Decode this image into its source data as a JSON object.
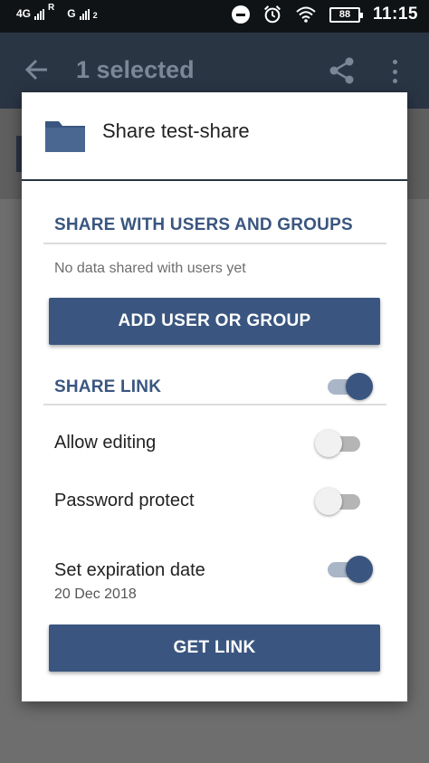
{
  "status_bar": {
    "network1": "4G",
    "roaming": "R",
    "network2": "G",
    "sim2": "2",
    "battery": "88",
    "time": "11:15"
  },
  "app_bar": {
    "title": "1 selected"
  },
  "dialog": {
    "title": "Share test-share",
    "users_section": {
      "title": "SHARE WITH USERS AND GROUPS",
      "empty_text": "No data shared with users yet",
      "add_button": "ADD USER OR GROUP"
    },
    "link_section": {
      "title": "SHARE LINK",
      "enabled": true,
      "options": [
        {
          "label": "Allow editing",
          "enabled": false
        },
        {
          "label": "Password protect",
          "enabled": false
        },
        {
          "label": "Set expiration date",
          "enabled": true,
          "sub": "20 Dec 2018"
        }
      ],
      "get_link_button": "GET LINK"
    }
  },
  "colors": {
    "accent": "#3a5680",
    "app_bar_dimmed": "#2a3544",
    "toggle_on_track": "#a9b6c7"
  }
}
